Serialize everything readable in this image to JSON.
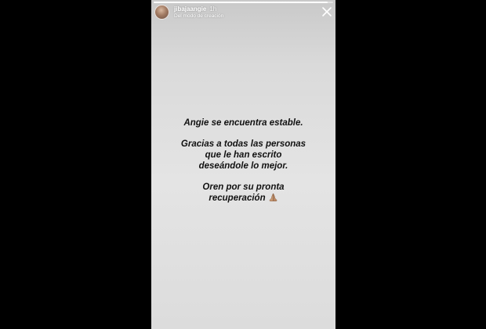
{
  "story": {
    "progress": 0.97,
    "header": {
      "username": "jibajaangie",
      "time": "1h",
      "subtitle": "Del modo de creación"
    },
    "message": {
      "line1": "Angie se encuentra estable.",
      "line2": "Gracias a todas las personas",
      "line3": "que le han escrito",
      "line4": "deseándole lo mejor.",
      "line5": "Oren por su pronta",
      "line6": "recuperación"
    },
    "icons": {
      "avatar": "profile-photo",
      "close": "close-icon",
      "emoji": "praying-hands-icon"
    }
  }
}
